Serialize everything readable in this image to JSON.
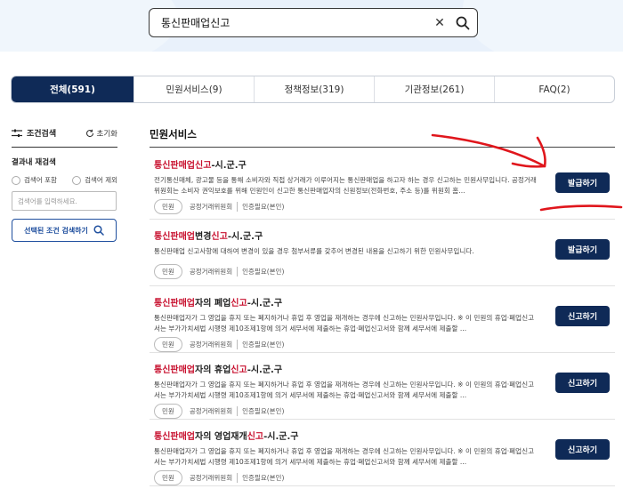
{
  "search": {
    "query": "통신판매업신고"
  },
  "tabs": [
    {
      "label": "전체(591)"
    },
    {
      "label": "민원서비스(9)"
    },
    {
      "label": "정책정보(319)"
    },
    {
      "label": "기관정보(261)"
    },
    {
      "label": "FAQ(2)"
    }
  ],
  "sidebar": {
    "title": "조건검색",
    "reset_label": "초기화",
    "subtitle": "결과내 재검색",
    "radio_include": "검색어 포함",
    "radio_exclude": "검색어 제외",
    "input_placeholder": "검색어를 입력하세요.",
    "search_button": "선택된 조건 검색하기"
  },
  "section_title": "민원서비스",
  "results": [
    {
      "title_hl": "통신판매업신고",
      "title_rest": "-시.군.구",
      "desc": "전기통신매체, 광고물 등을 통해 소비자와 직접 상거래가 이루어지는 통신판매업을 하고자 하는 경우 신고하는 민원사무입니다. 공정거래위원회는 소비자 권익보호를 위해 민원인이 신고한 통신판매업자의 신원정보(전화번호, 주소 등)를 위원회 홈...",
      "badge": "민원",
      "org": "공정거래위원회",
      "auth": "인증필요(본인)",
      "button": "발급하기"
    },
    {
      "title_hl": "통신판매업",
      "title_mid": "변경",
      "title_hl2": "신고",
      "title_rest": "-시.군.구",
      "desc": "통신판매업 신고사항에 대하여 변경이 있을 경우 첨부서류를 갖추어 변경된 내용을 신고하기 위한 민원사무입니다.",
      "badge": "민원",
      "org": "공정거래위원회",
      "auth": "인증필요(본인)",
      "button": "발급하기"
    },
    {
      "title_hl": "통신판매업",
      "title_mid": "자의 폐업",
      "title_hl2": "신고",
      "title_rest": "-시.군.구",
      "desc": "통신판매업자가 그 영업을 휴지 또는 폐지하거나 휴업 후 영업을 재개하는 경우에 신고하는 민원사무입니다. ※ 이 민원의 휴업·폐업신고서는 부가가치세법 시행령 제10조제1항에 의거 세무서에 제출하는 휴업·폐업신고서와 함께 세무서에 제출할 ...",
      "badge": "민원",
      "org": "공정거래위원회",
      "auth": "인증필요(본인)",
      "button": "신고하기"
    },
    {
      "title_hl": "통신판매업",
      "title_mid": "자의 휴업",
      "title_hl2": "신고",
      "title_rest": "-시.군.구",
      "desc": "통신판매업자가 그 영업을 휴지 또는 폐지하거나 휴업 후 영업을 재개하는 경우에 신고하는 민원사무입니다. ※ 이 민원의 휴업·폐업신고서는 부가가치세법 시행령 제10조제1항에 의거 세무서에 제출하는 휴업·폐업신고서와 함께 세무서에 제출할 ...",
      "badge": "민원",
      "org": "공정거래위원회",
      "auth": "인증필요(본인)",
      "button": "신고하기"
    },
    {
      "title_hl": "통신판매업",
      "title_mid": "자의 영업재개",
      "title_hl2": "신고",
      "title_rest": "-시.군.구",
      "desc": "통신판매업자가 그 영업을 휴지 또는 폐지하거나 휴업 후 영업을 재개하는 경우에 신고하는 민원사무입니다. ※ 이 민원의 휴업·폐업신고서는 부가가치세법 시행령 제10조제1항에 의거 세무서에 제출하는 휴업·폐업신고서와 함께 세무서에 제출할 ...",
      "badge": "민원",
      "org": "공정거래위원회",
      "auth": "인증필요(본인)",
      "button": "신고하기"
    }
  ],
  "colors": {
    "primary": "#0f2a57",
    "highlight": "#c8102e",
    "annotation": "#e0161c"
  }
}
